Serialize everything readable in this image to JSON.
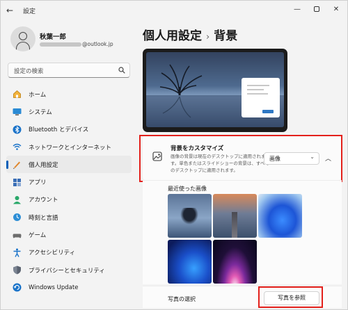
{
  "window": {
    "title": "設定",
    "back_icon": "back-arrow-icon",
    "controls": [
      "minimize-icon",
      "maximize-icon",
      "close-icon"
    ]
  },
  "account": {
    "name": "秋葉一郎",
    "email_suffix": "@outlook.jp"
  },
  "search": {
    "placeholder": "設定の検索"
  },
  "sidebar": {
    "items": [
      {
        "label": "ホーム",
        "icon": "home-icon"
      },
      {
        "label": "システム",
        "icon": "system-icon"
      },
      {
        "label": "Bluetooth とデバイス",
        "icon": "bluetooth-icon"
      },
      {
        "label": "ネットワークとインターネット",
        "icon": "network-icon"
      },
      {
        "label": "個人用設定",
        "icon": "personalization-icon",
        "active": true
      },
      {
        "label": "アプリ",
        "icon": "apps-icon"
      },
      {
        "label": "アカウント",
        "icon": "account-icon"
      },
      {
        "label": "時刻と言語",
        "icon": "time-language-icon"
      },
      {
        "label": "ゲーム",
        "icon": "gaming-icon"
      },
      {
        "label": "アクセシビリティ",
        "icon": "accessibility-icon"
      },
      {
        "label": "プライバシーとセキュリティ",
        "icon": "privacy-shield-icon"
      },
      {
        "label": "Windows Update",
        "icon": "windows-update-icon"
      }
    ]
  },
  "breadcrumb": {
    "parent": "個人用設定",
    "separator": "›",
    "current": "背景"
  },
  "background_setting": {
    "title": "背景をカスタマイズ",
    "description": "画像の背景は現在のデスクトップに適用されます。単色またはスライドショーの背景は、すべてのデスクトップに適用されます。",
    "selected_option": "画像",
    "icon": "image-icon"
  },
  "recent_images": {
    "label": "最近使った画像",
    "images": [
      "lake-tree-image",
      "pier-sunset-image",
      "blue-bloom-light-image",
      "blue-bloom-dark-image",
      "purple-glow-image"
    ]
  },
  "photo_picker": {
    "label": "写真の選択",
    "button_label": "写真を参照"
  },
  "colors": {
    "accent": "#005fb8",
    "highlight": "#e3201b"
  }
}
